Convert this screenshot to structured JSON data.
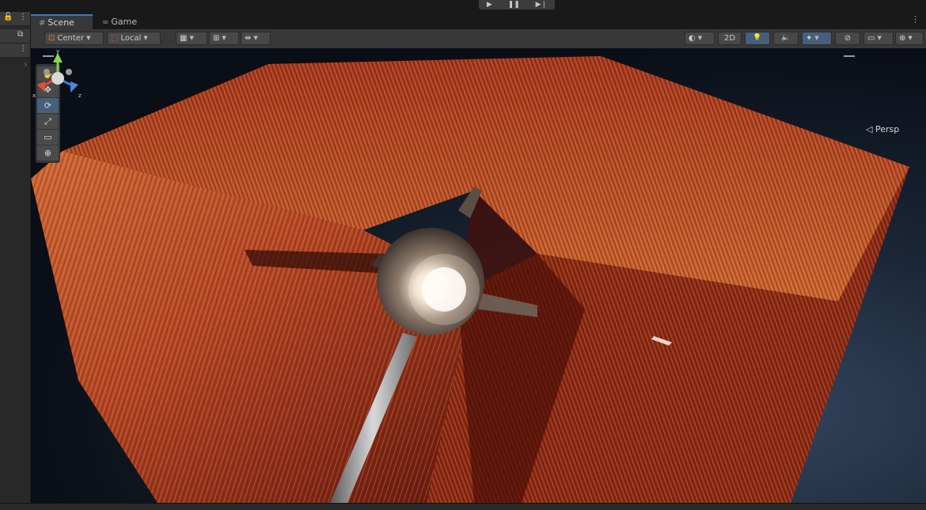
{
  "playbar": {
    "play": "▶",
    "pause": "❚❚",
    "step": "▶❘"
  },
  "left_panel": {
    "lock": "🔓",
    "menu": "⋮",
    "hierarchy": "⧉",
    "more": "⋮",
    "expand": "›"
  },
  "tabs": [
    {
      "label": "Scene",
      "icon": "#"
    },
    {
      "label": "Game",
      "icon": "∞"
    }
  ],
  "tab_menu": "⋮",
  "toolbar": {
    "pivot_label": "Center",
    "space_label": "Local",
    "mode_2d_label": "2D",
    "grid_icon": "▦",
    "snap_icon": "⊞",
    "increment_icon": "⇹",
    "draw_mode_icon": "◐",
    "light_icon": "💡",
    "audio_icon": "🔈",
    "fx_icon": "✦",
    "hidden_icon": "⊘",
    "camera_icon": "▭",
    "gizmos_icon": "⊕"
  },
  "tools": [
    "✋",
    "✥",
    "⟳",
    "⤢",
    "▭",
    "⊕"
  ],
  "gizmo": {
    "y": "y",
    "x": "x",
    "z": "z"
  },
  "persp_label": "◁ Persp",
  "colors": {
    "accent": "#3a79bb",
    "active_tool": "#46607c",
    "fur_orange": "#c65a2a",
    "fur_red": "#8a1f12",
    "background": "#0f1722"
  }
}
